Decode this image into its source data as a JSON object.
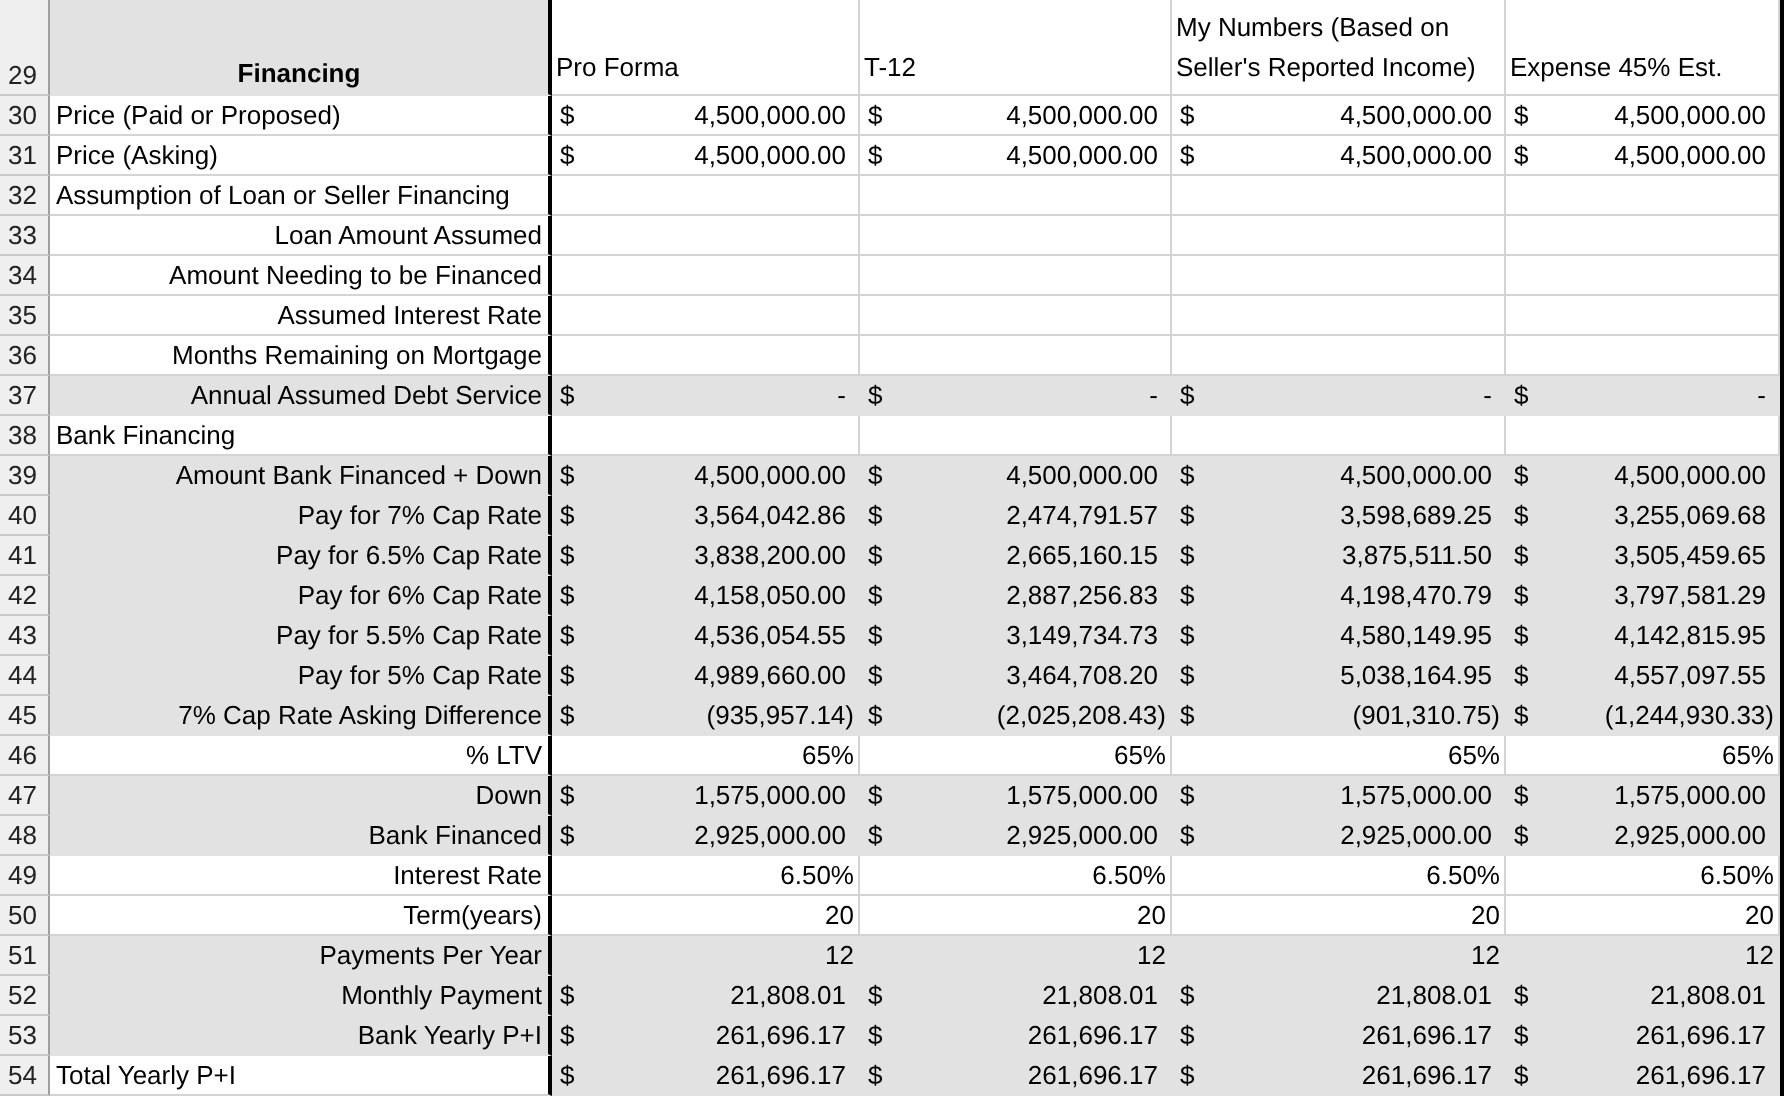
{
  "header": {
    "row_number": "29",
    "label": "Financing",
    "columns": [
      "Pro Forma",
      "T-12",
      "My Numbers (Based on Seller's Reported Income)",
      "Expense 45% Est."
    ]
  },
  "rows": [
    {
      "number": "30",
      "kind": "section",
      "label": "Price (Paid or Proposed)",
      "label_shaded": false,
      "values_shaded": false,
      "cells": [
        {
          "symbol": "$",
          "value": "4,500,000.00"
        },
        {
          "symbol": "$",
          "value": "4,500,000.00"
        },
        {
          "symbol": "$",
          "value": "4,500,000.00"
        },
        {
          "symbol": "$",
          "value": "4,500,000.00"
        }
      ]
    },
    {
      "number": "31",
      "kind": "section",
      "label": "Price (Asking)",
      "label_shaded": false,
      "values_shaded": false,
      "cells": [
        {
          "symbol": "$",
          "value": "4,500,000.00"
        },
        {
          "symbol": "$",
          "value": "4,500,000.00"
        },
        {
          "symbol": "$",
          "value": "4,500,000.00"
        },
        {
          "symbol": "$",
          "value": "4,500,000.00"
        }
      ]
    },
    {
      "number": "32",
      "kind": "section",
      "label": "Assumption of Loan or Seller Financing",
      "label_shaded": false,
      "values_shaded": false
    },
    {
      "number": "33",
      "kind": "item",
      "label": "Loan Amount Assumed",
      "label_shaded": false,
      "values_shaded": false
    },
    {
      "number": "34",
      "kind": "item",
      "label": "Amount Needing to be Financed",
      "label_shaded": false,
      "values_shaded": false
    },
    {
      "number": "35",
      "kind": "item",
      "label": "Assumed Interest Rate",
      "label_shaded": false,
      "values_shaded": false
    },
    {
      "number": "36",
      "kind": "item",
      "label": "Months Remaining on Mortgage",
      "label_shaded": false,
      "values_shaded": false
    },
    {
      "number": "37",
      "kind": "item",
      "label": "Annual Assumed Debt Service",
      "label_shaded": true,
      "values_shaded": true,
      "cells": [
        {
          "symbol": "$",
          "value": "-"
        },
        {
          "symbol": "$",
          "value": "-"
        },
        {
          "symbol": "$",
          "value": "-"
        },
        {
          "symbol": "$",
          "value": "-"
        }
      ]
    },
    {
      "number": "38",
      "kind": "section",
      "label": "Bank Financing",
      "label_shaded": false,
      "values_shaded": false
    },
    {
      "number": "39",
      "kind": "item",
      "label": "Amount Bank Financed + Down",
      "label_shaded": true,
      "values_shaded": true,
      "cells": [
        {
          "symbol": "$",
          "value": "4,500,000.00"
        },
        {
          "symbol": "$",
          "value": "4,500,000.00"
        },
        {
          "symbol": "$",
          "value": "4,500,000.00"
        },
        {
          "symbol": "$",
          "value": "4,500,000.00"
        }
      ]
    },
    {
      "number": "40",
      "kind": "item",
      "label": "Pay for 7% Cap Rate",
      "label_shaded": true,
      "values_shaded": true,
      "cells": [
        {
          "symbol": "$",
          "value": "3,564,042.86"
        },
        {
          "symbol": "$",
          "value": "2,474,791.57"
        },
        {
          "symbol": "$",
          "value": "3,598,689.25"
        },
        {
          "symbol": "$",
          "value": "3,255,069.68"
        }
      ]
    },
    {
      "number": "41",
      "kind": "item",
      "label": "Pay for 6.5% Cap Rate",
      "label_shaded": true,
      "values_shaded": true,
      "cells": [
        {
          "symbol": "$",
          "value": "3,838,200.00"
        },
        {
          "symbol": "$",
          "value": "2,665,160.15"
        },
        {
          "symbol": "$",
          "value": "3,875,511.50"
        },
        {
          "symbol": "$",
          "value": "3,505,459.65"
        }
      ]
    },
    {
      "number": "42",
      "kind": "item",
      "label": "Pay for 6% Cap Rate",
      "label_shaded": true,
      "values_shaded": true,
      "cells": [
        {
          "symbol": "$",
          "value": "4,158,050.00"
        },
        {
          "symbol": "$",
          "value": "2,887,256.83"
        },
        {
          "symbol": "$",
          "value": "4,198,470.79"
        },
        {
          "symbol": "$",
          "value": "3,797,581.29"
        }
      ]
    },
    {
      "number": "43",
      "kind": "item",
      "label": "Pay for 5.5% Cap Rate",
      "label_shaded": true,
      "values_shaded": true,
      "cells": [
        {
          "symbol": "$",
          "value": "4,536,054.55"
        },
        {
          "symbol": "$",
          "value": "3,149,734.73"
        },
        {
          "symbol": "$",
          "value": "4,580,149.95"
        },
        {
          "symbol": "$",
          "value": "4,142,815.95"
        }
      ]
    },
    {
      "number": "44",
      "kind": "item",
      "label": "Pay for 5% Cap Rate",
      "label_shaded": true,
      "values_shaded": true,
      "cells": [
        {
          "symbol": "$",
          "value": "4,989,660.00"
        },
        {
          "symbol": "$",
          "value": "3,464,708.20"
        },
        {
          "symbol": "$",
          "value": "5,038,164.95"
        },
        {
          "symbol": "$",
          "value": "4,557,097.55"
        }
      ]
    },
    {
      "number": "45",
      "kind": "item",
      "label": "7% Cap Rate Asking Difference",
      "label_shaded": true,
      "values_shaded": true,
      "cells": [
        {
          "symbol": "$",
          "value": "(935,957.14)"
        },
        {
          "symbol": "$",
          "value": "(2,025,208.43)"
        },
        {
          "symbol": "$",
          "value": "(901,310.75)"
        },
        {
          "symbol": "$",
          "value": "(1,244,930.33)"
        }
      ]
    },
    {
      "number": "46",
      "kind": "item",
      "label": "% LTV",
      "label_shaded": false,
      "values_shaded": false,
      "cells": [
        {
          "value": "65%"
        },
        {
          "value": "65%"
        },
        {
          "value": "65%"
        },
        {
          "value": "65%"
        }
      ]
    },
    {
      "number": "47",
      "kind": "item",
      "label": "Down",
      "label_shaded": true,
      "values_shaded": true,
      "cells": [
        {
          "symbol": "$",
          "value": "1,575,000.00"
        },
        {
          "symbol": "$",
          "value": "1,575,000.00"
        },
        {
          "symbol": "$",
          "value": "1,575,000.00"
        },
        {
          "symbol": "$",
          "value": "1,575,000.00"
        }
      ]
    },
    {
      "number": "48",
      "kind": "item",
      "label": "Bank Financed",
      "label_shaded": true,
      "values_shaded": true,
      "cells": [
        {
          "symbol": "$",
          "value": "2,925,000.00"
        },
        {
          "symbol": "$",
          "value": "2,925,000.00"
        },
        {
          "symbol": "$",
          "value": "2,925,000.00"
        },
        {
          "symbol": "$",
          "value": "2,925,000.00"
        }
      ]
    },
    {
      "number": "49",
      "kind": "item",
      "label": "Interest Rate",
      "label_shaded": false,
      "values_shaded": false,
      "cells": [
        {
          "value": "6.50%"
        },
        {
          "value": "6.50%"
        },
        {
          "value": "6.50%"
        },
        {
          "value": "6.50%"
        }
      ]
    },
    {
      "number": "50",
      "kind": "item",
      "label": "Term(years)",
      "label_shaded": false,
      "values_shaded": false,
      "cells": [
        {
          "value": "20"
        },
        {
          "value": "20"
        },
        {
          "value": "20"
        },
        {
          "value": "20"
        }
      ]
    },
    {
      "number": "51",
      "kind": "item",
      "label": "Payments Per Year",
      "label_shaded": true,
      "values_shaded": true,
      "cells": [
        {
          "value": "12"
        },
        {
          "value": "12"
        },
        {
          "value": "12"
        },
        {
          "value": "12"
        }
      ]
    },
    {
      "number": "52",
      "kind": "item",
      "label": "Monthly Payment",
      "label_shaded": true,
      "values_shaded": true,
      "cells": [
        {
          "symbol": "$",
          "value": "21,808.01"
        },
        {
          "symbol": "$",
          "value": "21,808.01"
        },
        {
          "symbol": "$",
          "value": "21,808.01"
        },
        {
          "symbol": "$",
          "value": "21,808.01"
        }
      ]
    },
    {
      "number": "53",
      "kind": "item",
      "label": "Bank Yearly P+I",
      "label_shaded": true,
      "values_shaded": true,
      "cells": [
        {
          "symbol": "$",
          "value": "261,696.17"
        },
        {
          "symbol": "$",
          "value": "261,696.17"
        },
        {
          "symbol": "$",
          "value": "261,696.17"
        },
        {
          "symbol": "$",
          "value": "261,696.17"
        }
      ]
    },
    {
      "number": "54",
      "kind": "section",
      "label": "Total Yearly P+I",
      "label_shaded": false,
      "values_shaded": true,
      "cells": [
        {
          "symbol": "$",
          "value": "261,696.17"
        },
        {
          "symbol": "$",
          "value": "261,696.17"
        },
        {
          "symbol": "$",
          "value": "261,696.17"
        },
        {
          "symbol": "$",
          "value": "261,696.17"
        }
      ]
    }
  ]
}
